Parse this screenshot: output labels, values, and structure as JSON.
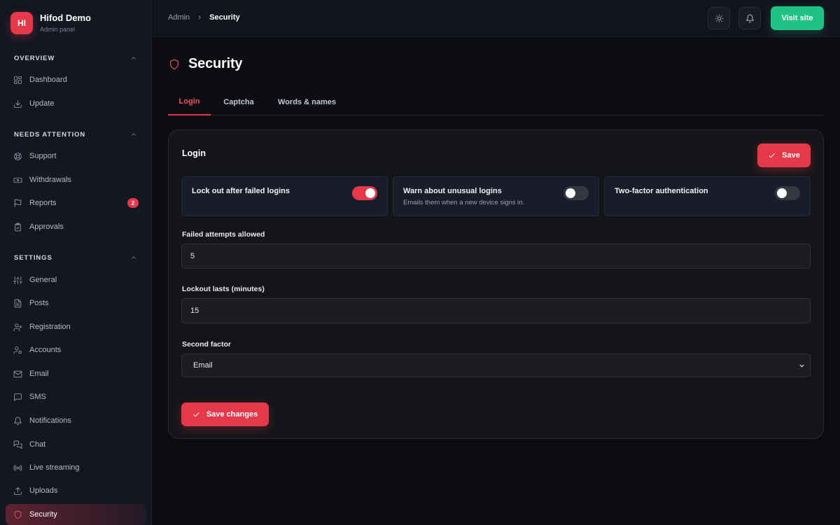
{
  "brand": {
    "initials": "HI",
    "name": "Hifod Demo",
    "subtitle": "Admin panel"
  },
  "sidebar": {
    "sections": [
      {
        "title": "OVERVIEW",
        "items": [
          {
            "label": "Dashboard",
            "icon": "dashboard-icon"
          },
          {
            "label": "Update",
            "icon": "download-icon"
          }
        ]
      },
      {
        "title": "NEEDS ATTENTION",
        "items": [
          {
            "label": "Support",
            "icon": "lifebuoy-icon"
          },
          {
            "label": "Withdrawals",
            "icon": "banknote-icon"
          },
          {
            "label": "Reports",
            "icon": "flag-icon",
            "badge": "2"
          },
          {
            "label": "Approvals",
            "icon": "clipboard-check-icon"
          }
        ]
      },
      {
        "title": "SETTINGS",
        "items": [
          {
            "label": "General",
            "icon": "sliders-icon"
          },
          {
            "label": "Posts",
            "icon": "file-text-icon"
          },
          {
            "label": "Registration",
            "icon": "user-plus-icon"
          },
          {
            "label": "Accounts",
            "icon": "user-cog-icon"
          },
          {
            "label": "Email",
            "icon": "mail-icon"
          },
          {
            "label": "SMS",
            "icon": "message-square-icon"
          },
          {
            "label": "Notifications",
            "icon": "bell-icon"
          },
          {
            "label": "Chat",
            "icon": "messages-icon"
          },
          {
            "label": "Live streaming",
            "icon": "radio-icon"
          },
          {
            "label": "Uploads",
            "icon": "upload-icon"
          },
          {
            "label": "Security",
            "icon": "shield-icon",
            "active": true
          }
        ]
      }
    ]
  },
  "topbar": {
    "breadcrumb": {
      "parent": "Admin",
      "current": "Security"
    },
    "visit_label": "Visit site"
  },
  "page": {
    "title": "Security",
    "tabs": [
      {
        "label": "Login",
        "active": true
      },
      {
        "label": "Captcha"
      },
      {
        "label": "Words & names"
      }
    ]
  },
  "card": {
    "title": "Login",
    "save_label": "Save",
    "toggles": [
      {
        "title": "Lock out after failed logins",
        "description": "",
        "on": true
      },
      {
        "title": "Warn about unusual logins",
        "description": "Emails them when a new device signs in.",
        "on": false
      },
      {
        "title": "Two-factor authentication",
        "description": "",
        "on": false
      }
    ],
    "fields": {
      "failed_attempts": {
        "label": "Failed attempts allowed",
        "value": "5"
      },
      "lockout_minutes": {
        "label": "Lockout lasts (minutes)",
        "value": "15"
      },
      "second_factor": {
        "label": "Second factor",
        "value": "Email"
      }
    },
    "save_changes_label": "Save changes"
  },
  "colors": {
    "accent": "#e5384a",
    "success": "#1ec285",
    "background": "#0b0d13",
    "sidebar": "#131722",
    "card": "#141519"
  }
}
